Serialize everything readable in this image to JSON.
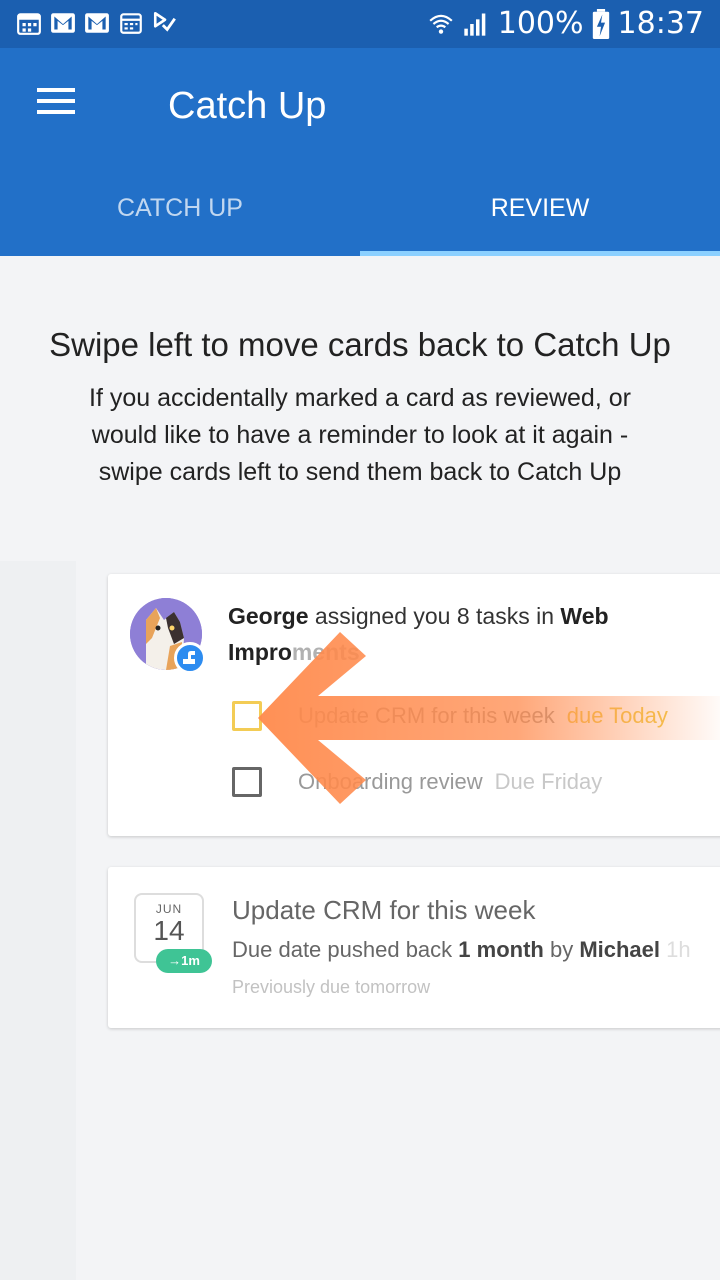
{
  "status_bar": {
    "left_icons": [
      "calendar-icon",
      "gmail-icon",
      "gmail-icon",
      "calendar-grid-icon",
      "checkmark-app-icon"
    ],
    "battery": "100%",
    "time": "18:37"
  },
  "app_bar": {
    "title": "Catch Up",
    "tabs": [
      {
        "label": "CATCH UP",
        "active": false
      },
      {
        "label": "REVIEW",
        "active": true
      }
    ]
  },
  "onboarding": {
    "headline": "Swipe left to move cards back to Catch Up",
    "subtext": "If you accidentally marked a card as reviewed, or would like to have a reminder to look at it again - swipe cards left to send them back to Catch Up"
  },
  "card_assign": {
    "actor": "George",
    "text": " assigned you 8 tasks in ",
    "project": "Web Impro",
    "project_rest": "ments",
    "tasks": [
      {
        "name": "Update CRM for this week",
        "due": "due Today"
      },
      {
        "name": "Onboarding review",
        "due": "Due Friday"
      }
    ]
  },
  "card_due": {
    "calendar_month": "JUN",
    "calendar_day": "14",
    "move_badge": "→1m",
    "title": "Update CRM for this week",
    "line_prefix": "Due date pushed back ",
    "line_amount": "1 month",
    "line_by": " by ",
    "line_actor": "Michael",
    "line_trailing": " 1h",
    "previous": "Previously due tomorrow"
  },
  "colors": {
    "status_bar": "#1b5fb0",
    "app_bar": "#2270c8",
    "tab_indicator": "#8bd0ff",
    "due_today": "#f2c94c",
    "arrow": "#ff8a4c",
    "badge_green": "#3fc495"
  }
}
